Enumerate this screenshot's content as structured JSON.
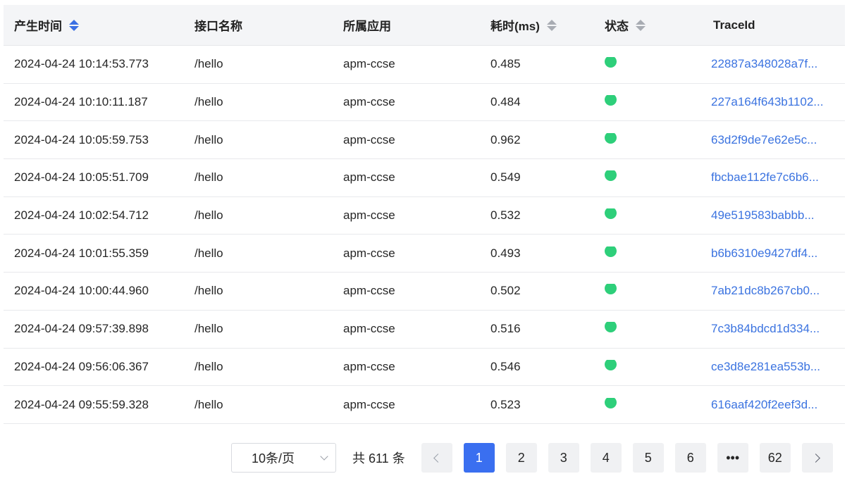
{
  "table": {
    "columns": [
      {
        "label": "产生时间",
        "sortable": true,
        "sort": "asc"
      },
      {
        "label": "接口名称",
        "sortable": false
      },
      {
        "label": "所属应用",
        "sortable": false
      },
      {
        "label": "耗时(ms)",
        "sortable": true,
        "sort": "none"
      },
      {
        "label": "状态",
        "sortable": true,
        "sort": "none"
      },
      {
        "label": "TraceId",
        "sortable": false
      }
    ],
    "rows": [
      {
        "time": "2024-04-24 10:14:53.773",
        "api": "/hello",
        "app": "apm-ccse",
        "duration": "0.485",
        "status_color": "#2ecf7a",
        "trace": "22887a348028a7f..."
      },
      {
        "time": "2024-04-24 10:10:11.187",
        "api": "/hello",
        "app": "apm-ccse",
        "duration": "0.484",
        "status_color": "#2ecf7a",
        "trace": "227a164f643b1102..."
      },
      {
        "time": "2024-04-24 10:05:59.753",
        "api": "/hello",
        "app": "apm-ccse",
        "duration": "0.962",
        "status_color": "#2ecf7a",
        "trace": "63d2f9de7e62e5c..."
      },
      {
        "time": "2024-04-24 10:05:51.709",
        "api": "/hello",
        "app": "apm-ccse",
        "duration": "0.549",
        "status_color": "#2ecf7a",
        "trace": "fbcbae112fe7c6b6..."
      },
      {
        "time": "2024-04-24 10:02:54.712",
        "api": "/hello",
        "app": "apm-ccse",
        "duration": "0.532",
        "status_color": "#2ecf7a",
        "trace": "49e519583babbb..."
      },
      {
        "time": "2024-04-24 10:01:55.359",
        "api": "/hello",
        "app": "apm-ccse",
        "duration": "0.493",
        "status_color": "#2ecf7a",
        "trace": "b6b6310e9427df4..."
      },
      {
        "time": "2024-04-24 10:00:44.960",
        "api": "/hello",
        "app": "apm-ccse",
        "duration": "0.502",
        "status_color": "#2ecf7a",
        "trace": "7ab21dc8b267cb0..."
      },
      {
        "time": "2024-04-24 09:57:39.898",
        "api": "/hello",
        "app": "apm-ccse",
        "duration": "0.516",
        "status_color": "#2ecf7a",
        "trace": "7c3b84bdcd1d334..."
      },
      {
        "time": "2024-04-24 09:56:06.367",
        "api": "/hello",
        "app": "apm-ccse",
        "duration": "0.546",
        "status_color": "#2ecf7a",
        "trace": "ce3d8e281ea553b..."
      },
      {
        "time": "2024-04-24 09:55:59.328",
        "api": "/hello",
        "app": "apm-ccse",
        "duration": "0.523",
        "status_color": "#2ecf7a",
        "trace": "616aaf420f2eef3d..."
      }
    ]
  },
  "pagination": {
    "page_size": "10条/页",
    "total": "共 611 条",
    "pages": [
      "1",
      "2",
      "3",
      "4",
      "5",
      "6",
      "•••",
      "62"
    ],
    "current": "1",
    "prev_icon": "chevron-left-icon",
    "next_icon": "chevron-right-icon"
  },
  "colors": {
    "accent": "#3a6ff0",
    "link": "#3b73e0",
    "status_ok": "#2ecf7a"
  }
}
